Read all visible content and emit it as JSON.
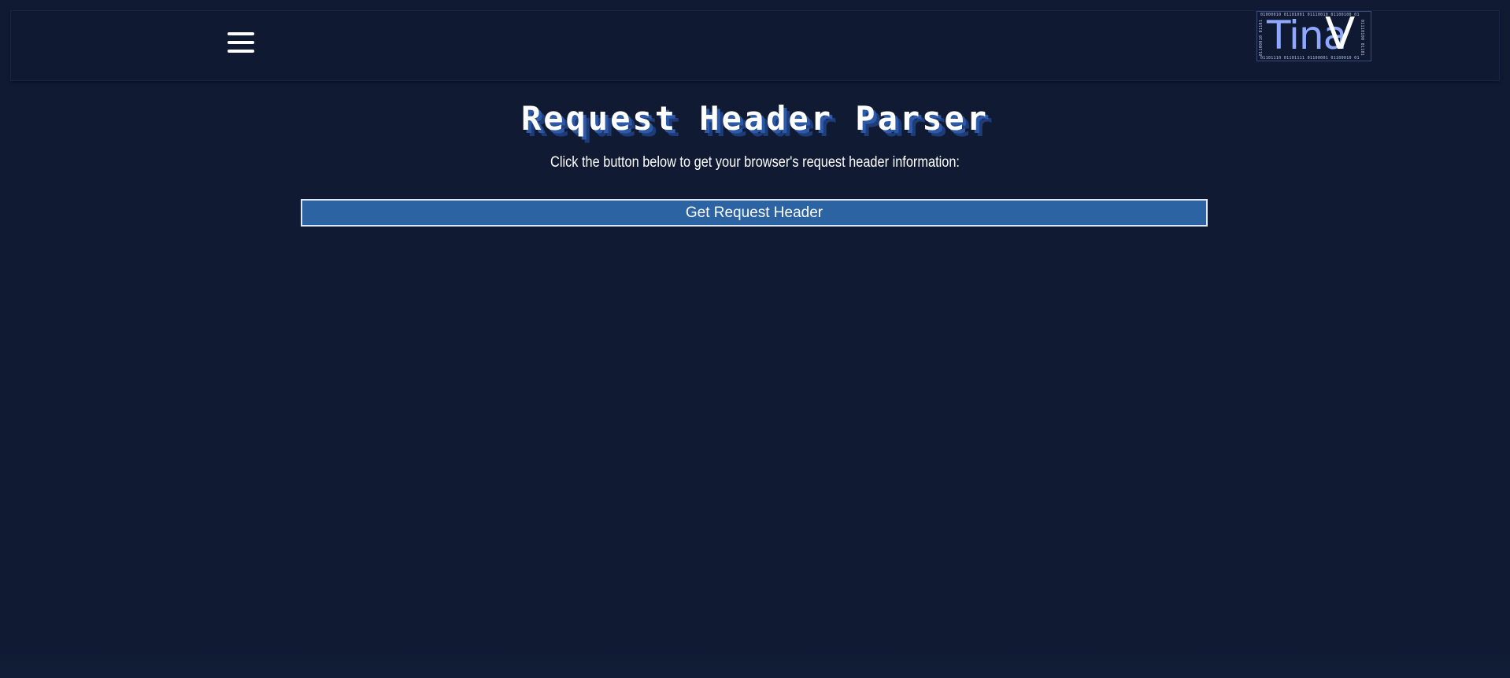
{
  "navbar": {
    "menu_icon": "hamburger-menu-icon",
    "logo": {
      "text": "Tina",
      "accent": "V",
      "binary_top": "01000010 01101001 01110010 01100100 01",
      "binary_bottom": "01101110 01101111 01100001 01100010 01",
      "binary_left": "01100010 01101",
      "binary_right": "01110100 01101"
    }
  },
  "main": {
    "title": "Request Header Parser",
    "subtitle": "Click the button below to get your browser's request header information:",
    "button_label": "Get Request Header"
  },
  "colors": {
    "background": "#101a33",
    "button": "#2b63a3",
    "logo_accent": "#8fa7ff",
    "title_shadow": "#2d5aa8"
  }
}
